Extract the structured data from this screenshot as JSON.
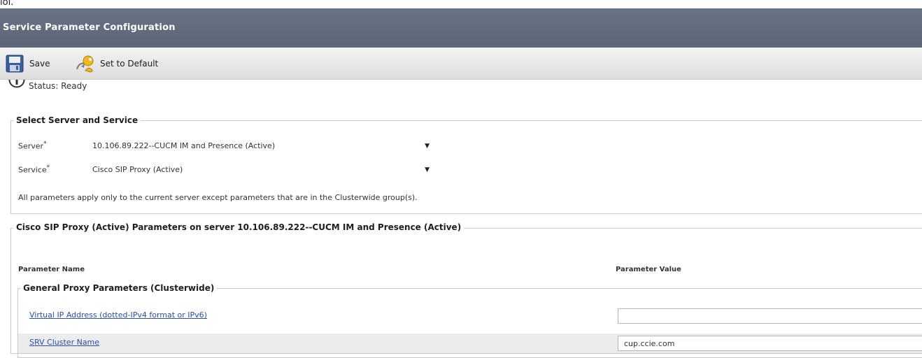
{
  "top_strip": {
    "text": "lol."
  },
  "header": {
    "title": "Service Parameter Configuration"
  },
  "toolbar": {
    "save_label": "Save",
    "set_default_label": "Set to Default"
  },
  "status": {
    "text": "Status: Ready"
  },
  "select_section": {
    "legend": "Select Server and Service",
    "server_label": "Server",
    "server_value": "10.106.89.222--CUCM IM and Presence (Active)",
    "service_label": "Service",
    "service_value": "Cisco SIP Proxy (Active)",
    "required_mark": "*",
    "note": "All parameters apply only to the current server except parameters that are in the Clusterwide group(s)."
  },
  "params_section": {
    "legend": "Cisco SIP Proxy (Active) Parameters on server 10.106.89.222--CUCM IM and Presence (Active)",
    "col_name": "Parameter Name",
    "col_value": "Parameter Value",
    "group_legend": "General Proxy Parameters (Clusterwide)",
    "rows": [
      {
        "name": "Virtual IP Address (dotted-IPv4 format or IPv6)",
        "value": ""
      },
      {
        "name": "SRV Cluster Name",
        "value": "cup.ccie.com"
      }
    ]
  }
}
